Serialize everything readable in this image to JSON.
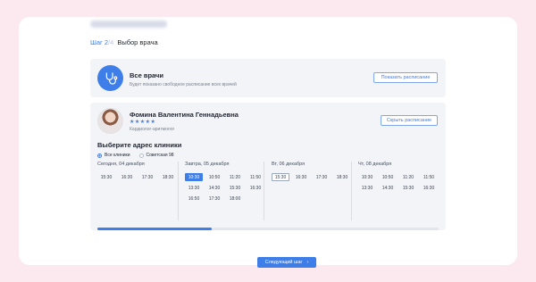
{
  "step": {
    "number": "Шаг 2",
    "total": "/4",
    "title": "Выбор врача"
  },
  "all_doctors": {
    "title": "Все врачи",
    "subtitle": "Будет показано свободное расписание всех врачей",
    "button": "Показать расписание",
    "icon": "stethoscope-icon"
  },
  "doctor": {
    "name": "Фомина Валентина Геннадьевна",
    "rating": "★★★★★",
    "specialty": "Кардиолог-аритмолог",
    "button": "Скрыть расписание"
  },
  "address": {
    "title": "Выберите адрес клиники",
    "options": [
      {
        "label": "Все клиники",
        "selected": true
      },
      {
        "label": "Советская 98",
        "selected": false
      }
    ]
  },
  "schedule": [
    {
      "label": "Сегодня, 04 декабря",
      "slots": [
        "15:30",
        "16:30",
        "17:30",
        "18:30"
      ]
    },
    {
      "label": "Завтра, 05 декабря",
      "slots": [
        "10:30",
        "10:50",
        "11:20",
        "11:50",
        "13:30",
        "14:30",
        "15:30",
        "16:30",
        "16:50",
        "17:30",
        "18:00"
      ]
    },
    {
      "label": "Вт, 06 декабря",
      "slots": [
        "15:30",
        "16:30",
        "17:30",
        "18:30"
      ]
    },
    {
      "label": "Чт, 08 декабря",
      "slots": [
        "10:30",
        "10:50",
        "11:20",
        "11:50",
        "13:30",
        "14:30",
        "15:30",
        "16:30"
      ]
    }
  ],
  "scroll_position": 0.33,
  "next_button": {
    "label": "Следующий шаг",
    "arrow": "›"
  },
  "colors": {
    "accent": "#3e7ee8",
    "page_bg": "#fbe9ef",
    "panel_bg": "#f2f4f7"
  }
}
